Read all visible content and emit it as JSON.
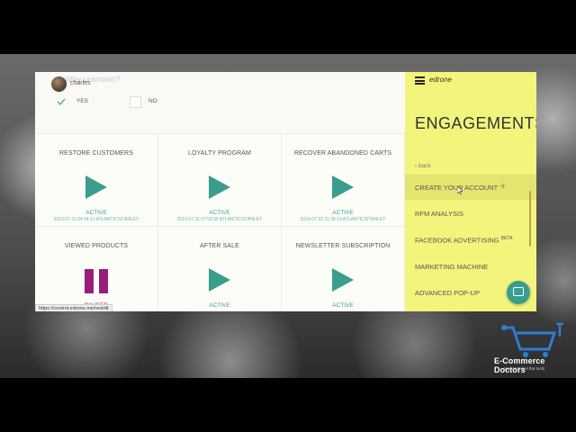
{
  "survey": {
    "question_ghost": "Why unknown?",
    "user_name": "charles",
    "yes_label": "YES",
    "no_label": "NO"
  },
  "tiles": [
    {
      "title": "RESTORE CUSTOMERS",
      "status": "ACTIVE",
      "date": "2019-07-11 04:34:13 ATLANTIC/STANLEY",
      "icon": "play-icon"
    },
    {
      "title": "LOYALTY PROGRAM",
      "status": "ACTIVE",
      "date": "2019-07-11 07:53:35 ATLANTIC/STANLEY",
      "icon": "play-icon"
    },
    {
      "title": "RECOVER ABANDONED CARTS",
      "status": "ACTIVE",
      "date": "2019-07-22 11:28:13 ATLANTIC/STANLEY",
      "icon": "play-icon"
    },
    {
      "title": "VIEWED PRODUCTS",
      "status": "PAUSED",
      "date": "",
      "icon": "pause-icon"
    },
    {
      "title": "AFTER SALE",
      "status": "ACTIVE",
      "date": "",
      "icon": "play-icon"
    },
    {
      "title": "NEWSLETTER SUBSCRIPTION",
      "status": "ACTIVE",
      "date": "",
      "icon": "play-icon"
    }
  ],
  "status_bar_url": "https://control.edrone.me/rest/dt",
  "sidebar": {
    "brand": "edrone",
    "title": "ENGAGEMENTS",
    "back_label": "‹ back",
    "items": [
      {
        "label": "CREATE YOUR ACCOUNT",
        "active": true
      },
      {
        "label": "RFM ANALYSIS"
      },
      {
        "label": "FACEBOOK ADVERTISING",
        "sup": "BETA"
      },
      {
        "label": "MARKETING MACHINE"
      },
      {
        "label": "ADVANCED POP-UP"
      }
    ]
  },
  "watermark": {
    "name": "E-Commerce Doctors",
    "tagline": "You can't feel the tools"
  },
  "colors": {
    "accent": "#3a9e8e",
    "paused": "#9a1c7a",
    "sidebar": "#f3f47c"
  }
}
